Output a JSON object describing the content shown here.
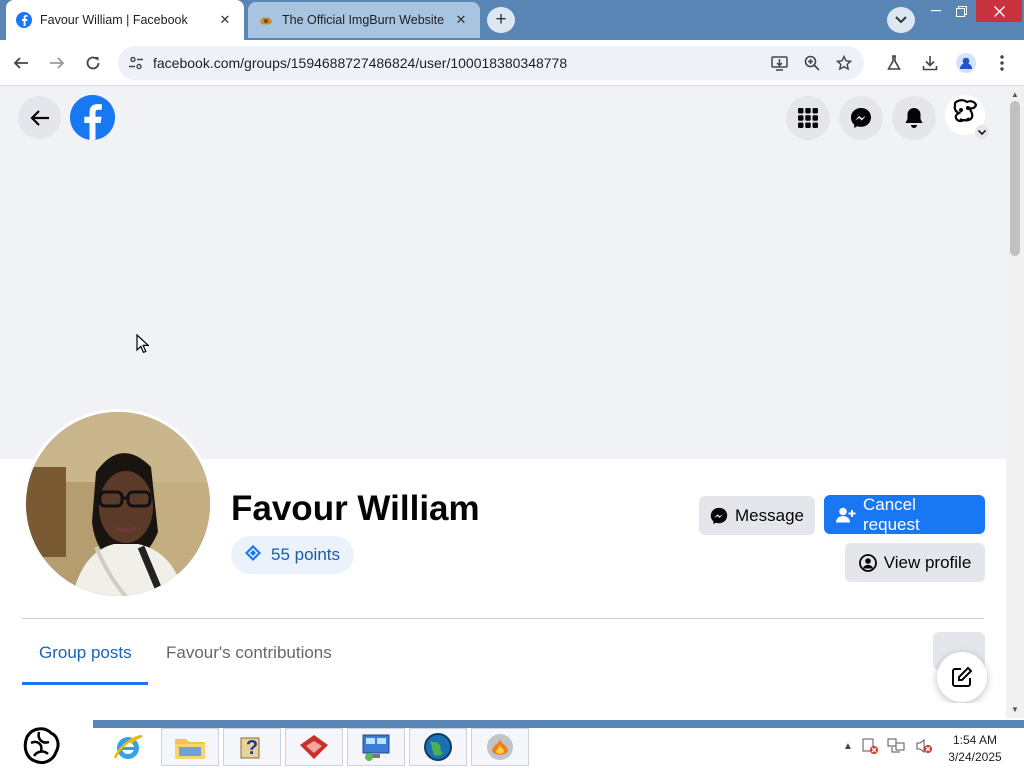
{
  "browser": {
    "tabs": [
      {
        "title": "Favour William | Facebook",
        "active": true,
        "favicon": "facebook-favicon"
      },
      {
        "title": "The Official ImgBurn Website",
        "active": false,
        "favicon": "imgburn-favicon"
      }
    ],
    "new_tab_symbol": "+",
    "url": "facebook.com/groups/1594688727486824/user/100018380348778"
  },
  "page": {
    "name": "Favour William",
    "points": "55 points",
    "buttons": {
      "message": "Message",
      "cancel_request": "Cancel request",
      "view_profile": "View profile"
    },
    "tabs": [
      "Group posts",
      "Favour's contributions"
    ],
    "active_tab": "Group posts"
  },
  "taskbar": {
    "time": "1:54 AM",
    "date": "3/24/2025",
    "apps": [
      "internet-explorer-icon",
      "file-explorer-icon",
      "help-icon",
      "red-app-icon",
      "network-app-icon",
      "globe-app-icon",
      "imgburn-app-icon"
    ]
  },
  "colors": {
    "facebook_blue": "#1877f2",
    "titlebar": "#5a86b5",
    "page_bg": "#f0f2f5"
  }
}
